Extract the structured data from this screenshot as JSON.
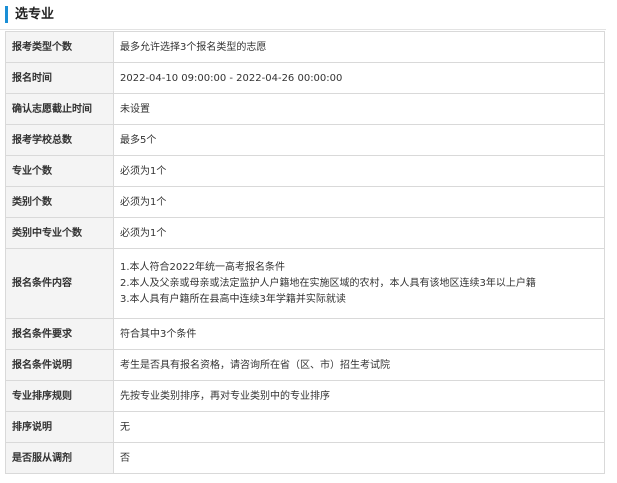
{
  "section": {
    "title": "选专业"
  },
  "rows": [
    {
      "label": "报考类型个数",
      "value": "最多允许选择3个报名类型的志愿"
    },
    {
      "label": "报名时间",
      "value": "2022-04-10 09:00:00 - 2022-04-26 00:00:00"
    },
    {
      "label": "确认志愿截止时间",
      "value": "未设置"
    },
    {
      "label": "报考学校总数",
      "value": "最多5个"
    },
    {
      "label": "专业个数",
      "value": "必须为1个"
    },
    {
      "label": "类别个数",
      "value": "必须为1个"
    },
    {
      "label": "类别中专业个数",
      "value": "必须为1个"
    },
    {
      "label": "报名条件内容",
      "lines": [
        "1.本人符合2022年统一高考报名条件",
        "2.本人及父亲或母亲或法定监护人户籍地在实施区域的农村，本人具有该地区连续3年以上户籍",
        "3.本人具有户籍所在县高中连续3年学籍并实际就读"
      ]
    },
    {
      "label": "报名条件要求",
      "value": "符合其中3个条件"
    },
    {
      "label": "报名条件说明",
      "value": "考生是否具有报名资格，请咨询所在省（区、市）招生考试院"
    },
    {
      "label": "专业排序规则",
      "value": "先按专业类别排序，再对专业类别中的专业排序"
    },
    {
      "label": "排序说明",
      "value": "无"
    },
    {
      "label": "是否服从调剂",
      "value": "否"
    }
  ]
}
